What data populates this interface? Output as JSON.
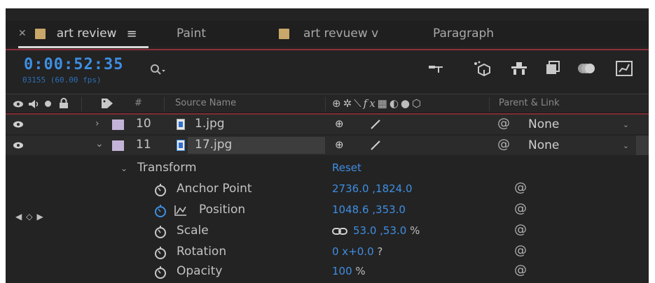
{
  "tabs": [
    {
      "label": "art review",
      "active": true,
      "menu_icon": "hamburger-icon"
    },
    {
      "label": "Paint",
      "active": false
    },
    {
      "label": "art revuew v",
      "active": false
    },
    {
      "label": "Paragraph",
      "active": false
    }
  ],
  "composition": {
    "timecode": "0:00:52:35",
    "fps_readout": "03155 (60.00 fps)"
  },
  "columns": {
    "source_name": "Source Name",
    "parent_link": "Parent & Link",
    "hash": "#"
  },
  "layers": [
    {
      "number": "10",
      "name": "1.jpg",
      "parent": "None",
      "expanded": false
    },
    {
      "number": "11",
      "name": "17.jpg",
      "parent": "None",
      "expanded": true
    }
  ],
  "transform": {
    "group_label": "Transform",
    "reset_label": "Reset",
    "properties": [
      {
        "label": "Anchor Point",
        "value": "2736.0 ,1824.0",
        "unit": ""
      },
      {
        "label": "Position",
        "value": "1048.6 ,353.0",
        "unit": ""
      },
      {
        "label": "Scale",
        "value": "53.0 ,53.0",
        "unit": "%"
      },
      {
        "label": "Rotation",
        "value": "0 x+0.0",
        "unit": "?"
      },
      {
        "label": "Opacity",
        "value": "100",
        "unit": "%"
      }
    ]
  },
  "colors": {
    "accent_blue": "#3f8ee2",
    "panel_bg": "#232323",
    "label_lavender": "#c3b3d8",
    "tab_swatch": "#c9a76a",
    "red_line": "#a8323e"
  }
}
